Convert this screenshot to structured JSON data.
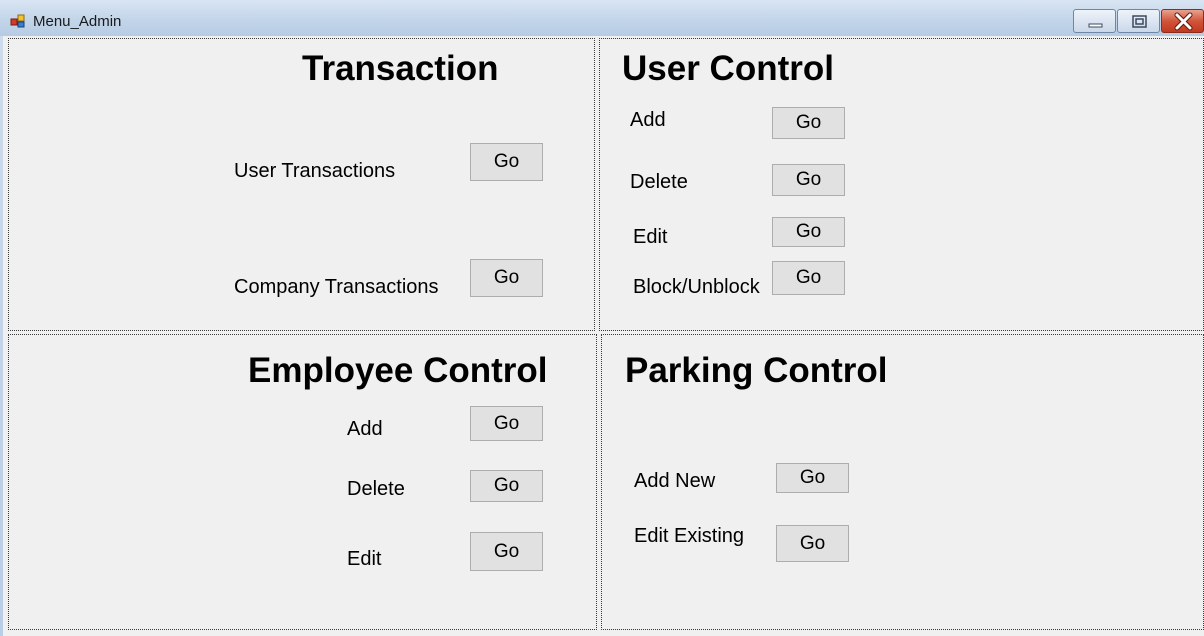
{
  "window": {
    "title": "Menu_Admin",
    "controls": [
      "minimize-icon",
      "maximize-icon",
      "close-icon"
    ]
  },
  "transaction": {
    "heading": "Transaction",
    "items": [
      {
        "label": "User Transactions",
        "button": "Go"
      },
      {
        "label": "Company Transactions",
        "button": "Go"
      }
    ]
  },
  "user_control": {
    "heading": "User Control",
    "items": [
      {
        "label": "Add",
        "button": "Go"
      },
      {
        "label": "Delete",
        "button": "Go"
      },
      {
        "label": "Edit",
        "button": "Go"
      },
      {
        "label": "Block/Unblock",
        "button": "Go"
      }
    ]
  },
  "employee_control": {
    "heading": "Employee Control",
    "items": [
      {
        "label": "Add",
        "button": "Go"
      },
      {
        "label": "Delete",
        "button": "Go"
      },
      {
        "label": "Edit",
        "button": "Go"
      }
    ]
  },
  "parking_control": {
    "heading": "Parking Control",
    "items": [
      {
        "label": "Add New",
        "button": "Go"
      },
      {
        "label": "Edit Existing",
        "button": "Go"
      }
    ]
  }
}
